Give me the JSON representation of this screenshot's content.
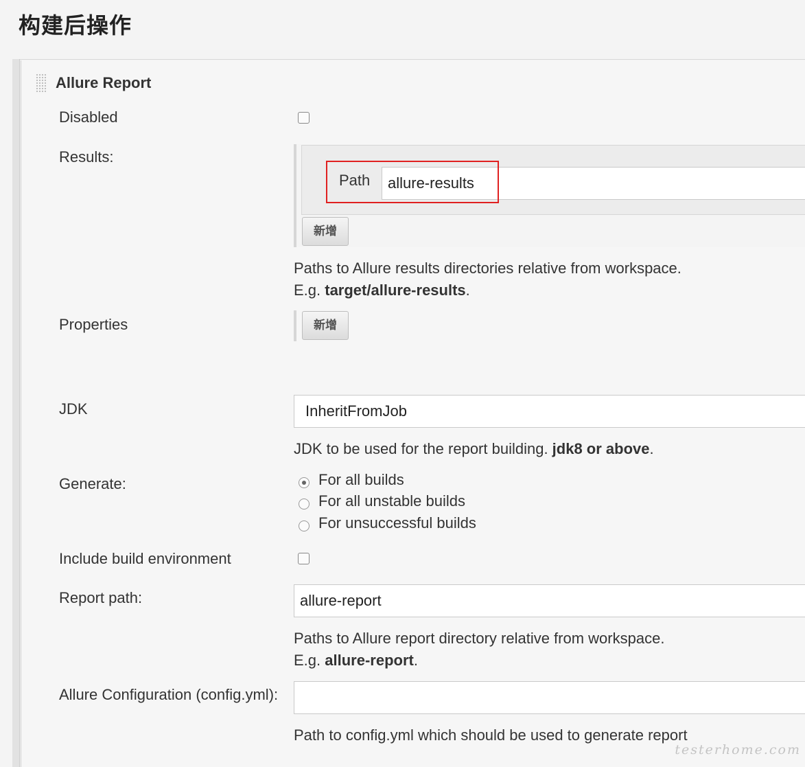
{
  "section": {
    "title": "构建后操作"
  },
  "panel": {
    "title": "Allure Report"
  },
  "fields": {
    "disabled_label": "Disabled",
    "results_label": "Results:",
    "path_label": "Path",
    "path_value": "allure-results",
    "results_add_button": "新增",
    "results_help_line1": "Paths to Allure results directories relative from workspace.",
    "results_help_eg": "E.g. ",
    "results_help_example": "target/allure-results",
    "results_help_period": ".",
    "properties_label": "Properties",
    "properties_add_button": "新增",
    "jdk_label": "JDK",
    "jdk_value": "InheritFromJob",
    "jdk_help_text": "JDK to be used for the report building. ",
    "jdk_help_bold": "jdk8 or above",
    "jdk_help_period": ".",
    "generate_label": "Generate:",
    "generate_options": [
      {
        "label": "For all builds",
        "checked": true
      },
      {
        "label": "For all unstable builds",
        "checked": false
      },
      {
        "label": "For unsuccessful builds",
        "checked": false
      }
    ],
    "include_env_label": "Include build environment",
    "report_path_label": "Report path:",
    "report_path_value": "allure-report",
    "report_help_line1": "Paths to Allure report directory relative from workspace.",
    "report_help_eg": "E.g. ",
    "report_help_example": "allure-report",
    "report_help_period": ".",
    "config_label": "Allure Configuration (config.yml):",
    "config_value": "",
    "config_help": "Path to config.yml which should be used to generate report"
  },
  "watermark": "testerhome.com",
  "colors": {
    "highlight": "#e02020",
    "background": "#f4f4f4"
  }
}
